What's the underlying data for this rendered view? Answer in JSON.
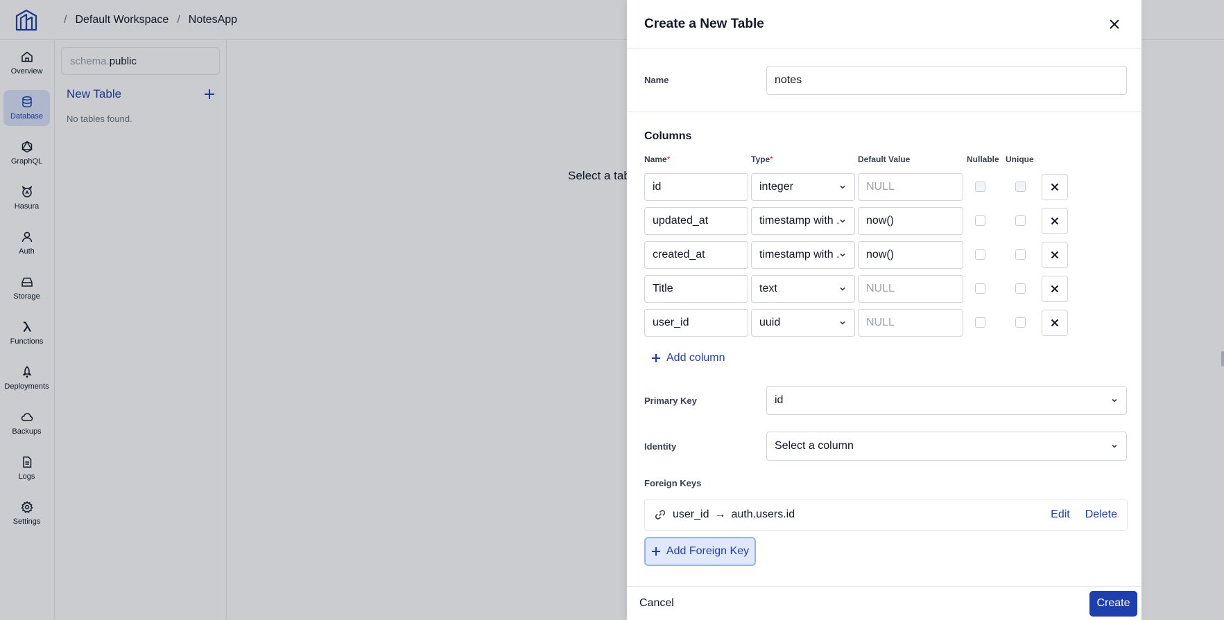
{
  "breadcrumb": {
    "workspace": "Default Workspace",
    "project": "NotesApp",
    "separator": "/"
  },
  "nav": {
    "items": [
      {
        "label": "Overview",
        "icon": "home-icon"
      },
      {
        "label": "Database",
        "icon": "database-icon",
        "active": true
      },
      {
        "label": "GraphQL",
        "icon": "graphql-icon"
      },
      {
        "label": "Hasura",
        "icon": "hasura-icon"
      },
      {
        "label": "Auth",
        "icon": "user-icon"
      },
      {
        "label": "Storage",
        "icon": "storage-icon"
      },
      {
        "label": "Functions",
        "icon": "lambda-icon"
      },
      {
        "label": "Deployments",
        "icon": "rocket-icon"
      },
      {
        "label": "Backups",
        "icon": "cloud-icon"
      },
      {
        "label": "Logs",
        "icon": "file-icon"
      },
      {
        "label": "Settings",
        "icon": "gear-icon"
      }
    ]
  },
  "sidepanel": {
    "schema_prefix": "schema.",
    "schema_name": "public",
    "new_table_label": "New Table",
    "empty_text": "No tables found."
  },
  "main": {
    "placeholder": "Select a tab"
  },
  "drawer": {
    "title": "Create a New Table",
    "name_label": "Name",
    "name_value": "notes",
    "columns_title": "Columns",
    "headers": {
      "name": "Name",
      "type": "Type",
      "default": "Default Value",
      "nullable": "Nullable",
      "unique": "Unique",
      "required_mark": "*"
    },
    "columns": [
      {
        "name": "id",
        "type": "integer",
        "default": "",
        "default_placeholder": "NULL"
      },
      {
        "name": "updated_at",
        "type": "timestamp with ...",
        "default": "now()",
        "default_placeholder": "NULL"
      },
      {
        "name": "created_at",
        "type": "timestamp with ...",
        "default": "now()",
        "default_placeholder": "NULL"
      },
      {
        "name": "Title",
        "type": "text",
        "default": "",
        "default_placeholder": "NULL"
      },
      {
        "name": "user_id",
        "type": "uuid",
        "default": "",
        "default_placeholder": "NULL"
      }
    ],
    "add_column_label": "Add column",
    "primary_key_label": "Primary Key",
    "primary_key_value": "id",
    "identity_label": "Identity",
    "identity_value": "Select a column",
    "foreign_keys_label": "Foreign Keys",
    "foreign_key": {
      "from": "user_id",
      "to": "auth.users.id",
      "edit_label": "Edit",
      "delete_label": "Delete"
    },
    "add_foreign_key_label": "Add Foreign Key",
    "cancel_label": "Cancel",
    "create_label": "Create"
  },
  "colors": {
    "accent": "#1e40af",
    "active_nav_bg": "#dbe5f9",
    "danger": "#dc2626"
  }
}
